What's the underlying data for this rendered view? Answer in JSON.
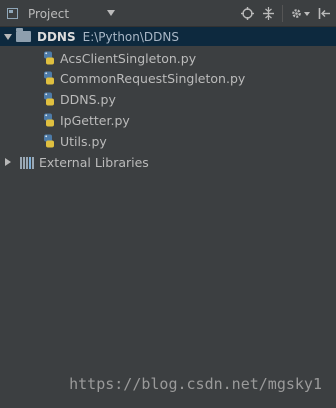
{
  "toolbar": {
    "view_label": "Project",
    "icons": [
      "locate-icon",
      "collapse-all-icon",
      "gear-icon",
      "hide-icon"
    ]
  },
  "tree": {
    "root": {
      "name": "DDNS",
      "path": "E:\\Python\\DDNS"
    },
    "files": [
      "AcsClientSingleton.py",
      "CommonRequestSingleton.py",
      "DDNS.py",
      "IpGetter.py",
      "Utils.py"
    ],
    "external": "External Libraries"
  },
  "watermark": "https://blog.csdn.net/mgsky1",
  "colors": {
    "panel_bg": "#3c3f41",
    "selection_bg": "#0d293e",
    "text": "#bbbbbb"
  }
}
